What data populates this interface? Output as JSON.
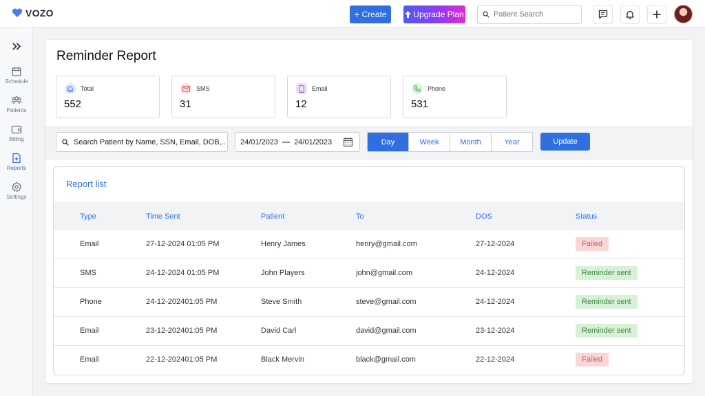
{
  "app": {
    "name": "VOZO"
  },
  "topbar": {
    "create_label": "Create",
    "upgrade_label": "Upgrade Plan",
    "search_placeholder": "Patient Search"
  },
  "sidebar": {
    "items": [
      {
        "label": "Schedule",
        "icon": "calendar-icon"
      },
      {
        "label": "Patients",
        "icon": "patients-icon"
      },
      {
        "label": "Billing",
        "icon": "wallet-icon"
      },
      {
        "label": "Reports",
        "icon": "report-icon",
        "active": true
      },
      {
        "label": "Settings",
        "icon": "gear-icon"
      }
    ]
  },
  "page": {
    "title": "Reminder Report"
  },
  "stats": [
    {
      "label": "Total",
      "value": "552",
      "icon": "bell-icon",
      "color": "#2f6fe0"
    },
    {
      "label": "SMS",
      "value": "31",
      "icon": "mail-icon",
      "color": "#e25555"
    },
    {
      "label": "Email",
      "value": "12",
      "icon": "tablet-icon",
      "color": "#9b59d0"
    },
    {
      "label": "Phone",
      "value": "531",
      "icon": "phone-icon",
      "color": "#3d9b3d"
    }
  ],
  "filters": {
    "search_placeholder": "Search Patient by Name, SSN, Email, DOB,..",
    "date_from": "24/01/2023",
    "date_to": "24/01/2023",
    "periods": [
      "Day",
      "Week",
      "Month",
      "Year"
    ],
    "active_period": "Day",
    "update_label": "Update"
  },
  "report": {
    "title": "Report list",
    "columns": [
      "Type",
      "Time Sent",
      "Patient",
      "To",
      "DOS",
      "Status"
    ],
    "rows": [
      {
        "type": "Email",
        "time_sent": "27-12-2024 01:05 PM",
        "patient": "Henry James",
        "to": "henry@gmail.com",
        "dos": "27-12-2024",
        "status": "Failed"
      },
      {
        "type": "SMS",
        "time_sent": "24-12-2024 01:05 PM",
        "patient": "John Players",
        "to": "john@gmail.com",
        "dos": "24-12-2024",
        "status": "Reminder sent"
      },
      {
        "type": "Phone",
        "time_sent": "24-12-202401:05 PM",
        "patient": "Steve Smith",
        "to": "steve@gmail.com",
        "dos": "24-12-2024",
        "status": "Reminder sent"
      },
      {
        "type": "Email",
        "time_sent": "23-12-202401:05 PM",
        "patient": "David Carl",
        "to": "david@gmail.com",
        "dos": "23-12-2024",
        "status": "Reminder sent"
      },
      {
        "type": "Email",
        "time_sent": "22-12-202401:05 PM",
        "patient": "Black Mervin",
        "to": "black@gmail.com",
        "dos": "22-12-2024",
        "status": "Failed"
      }
    ]
  },
  "colors": {
    "accent": "#2f6fe0",
    "failed_bg": "#f9d7d7",
    "failed_text": "#d9534f",
    "sent_bg": "#d8efd8",
    "sent_text": "#3d8b3d"
  }
}
